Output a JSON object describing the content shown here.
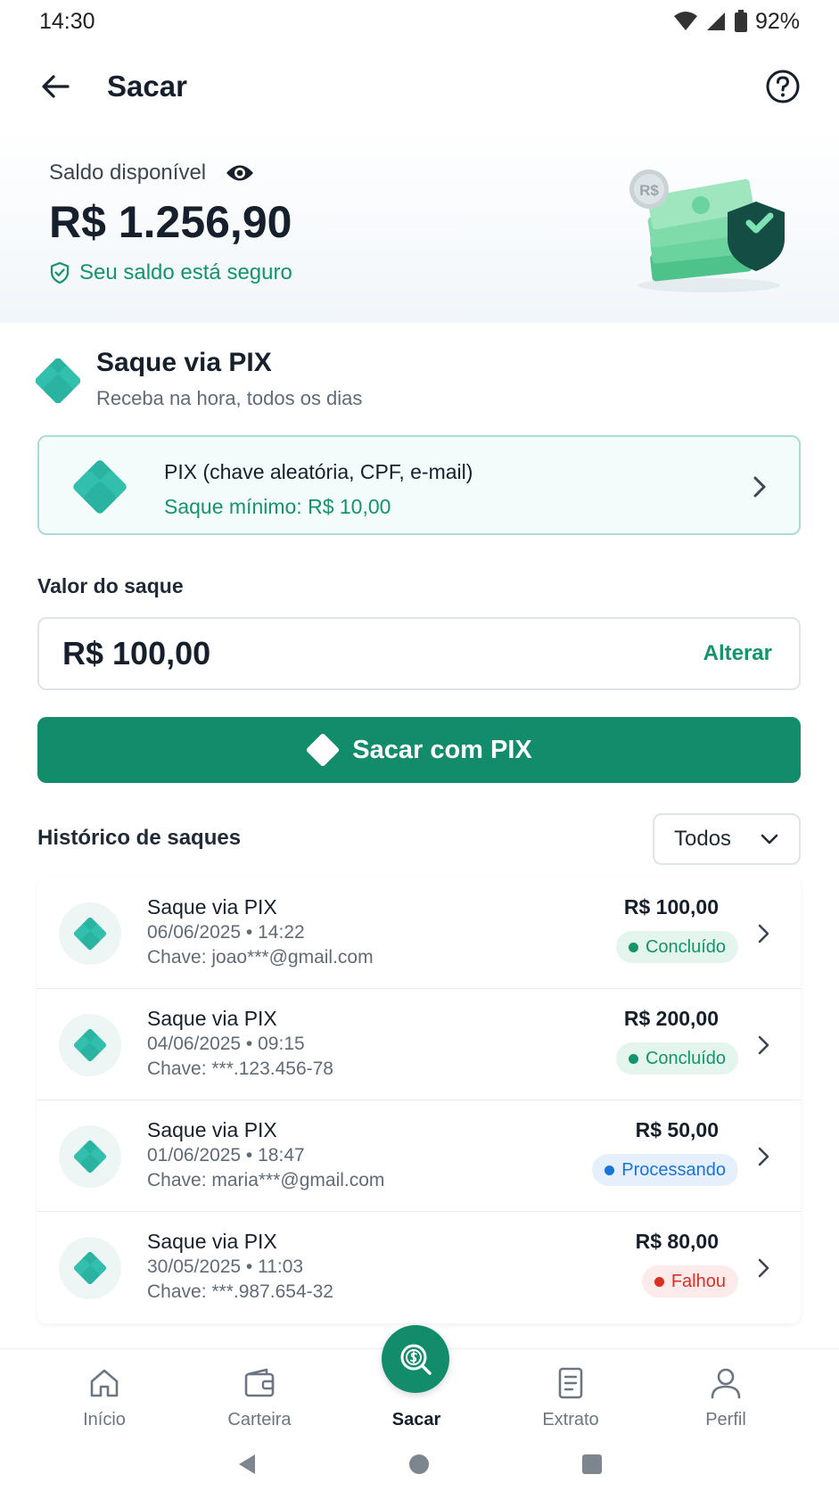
{
  "status_bar": {
    "time": "14:30",
    "battery": "92%"
  },
  "app_bar": {
    "title": "Sacar"
  },
  "balance": {
    "label": "Saldo disponível",
    "amount": "R$ 1.256,90",
    "secure_text": "Seu saldo está seguro",
    "illustration_currency": "R$"
  },
  "pix_section": {
    "title": "Saque via PIX",
    "subtitle": "Receba na hora, todos os dias",
    "method": {
      "title": "PIX (chave aleatória, CPF, e-mail)",
      "minimum": "Saque mínimo: R$ 10,00"
    }
  },
  "amount_input": {
    "label": "Valor do saque",
    "value": "R$ 100,00",
    "change_label": "Alterar"
  },
  "primary_button": {
    "label": "Sacar com PIX"
  },
  "history": {
    "title": "Histórico de saques",
    "filter": "Todos",
    "items": [
      {
        "title": "Saque via PIX",
        "datetime": "06/06/2025 • 14:22",
        "key": "Chave: joao***@gmail.com",
        "amount": "R$ 100,00",
        "status": "Concluído"
      },
      {
        "title": "Saque via PIX",
        "datetime": "04/06/2025 • 09:15",
        "key": "Chave: ***.123.456-78",
        "amount": "R$ 200,00",
        "status": "Concluído"
      },
      {
        "title": "Saque via PIX",
        "datetime": "01/06/2025 • 18:47",
        "key": "Chave: maria***@gmail.com",
        "amount": "R$ 50,00",
        "status": "Processando"
      },
      {
        "title": "Saque via PIX",
        "datetime": "30/05/2025 • 11:03",
        "key": "Chave: ***.987.654-32",
        "amount": "R$ 80,00",
        "status": "Falhou"
      }
    ]
  },
  "status_colors": {
    "completed": "#14946a",
    "processing": "#1a73d9",
    "failed": "#d93025",
    "brand": "#128c6a"
  },
  "bottom_nav": {
    "items": [
      {
        "label": "Início",
        "icon": "home-icon"
      },
      {
        "label": "Carteira",
        "icon": "wallet-icon"
      },
      {
        "label": "Sacar",
        "icon": "withdraw-icon"
      },
      {
        "label": "Extrato",
        "icon": "statement-icon"
      },
      {
        "label": "Perfil",
        "icon": "profile-icon"
      }
    ],
    "active": "Sacar"
  }
}
